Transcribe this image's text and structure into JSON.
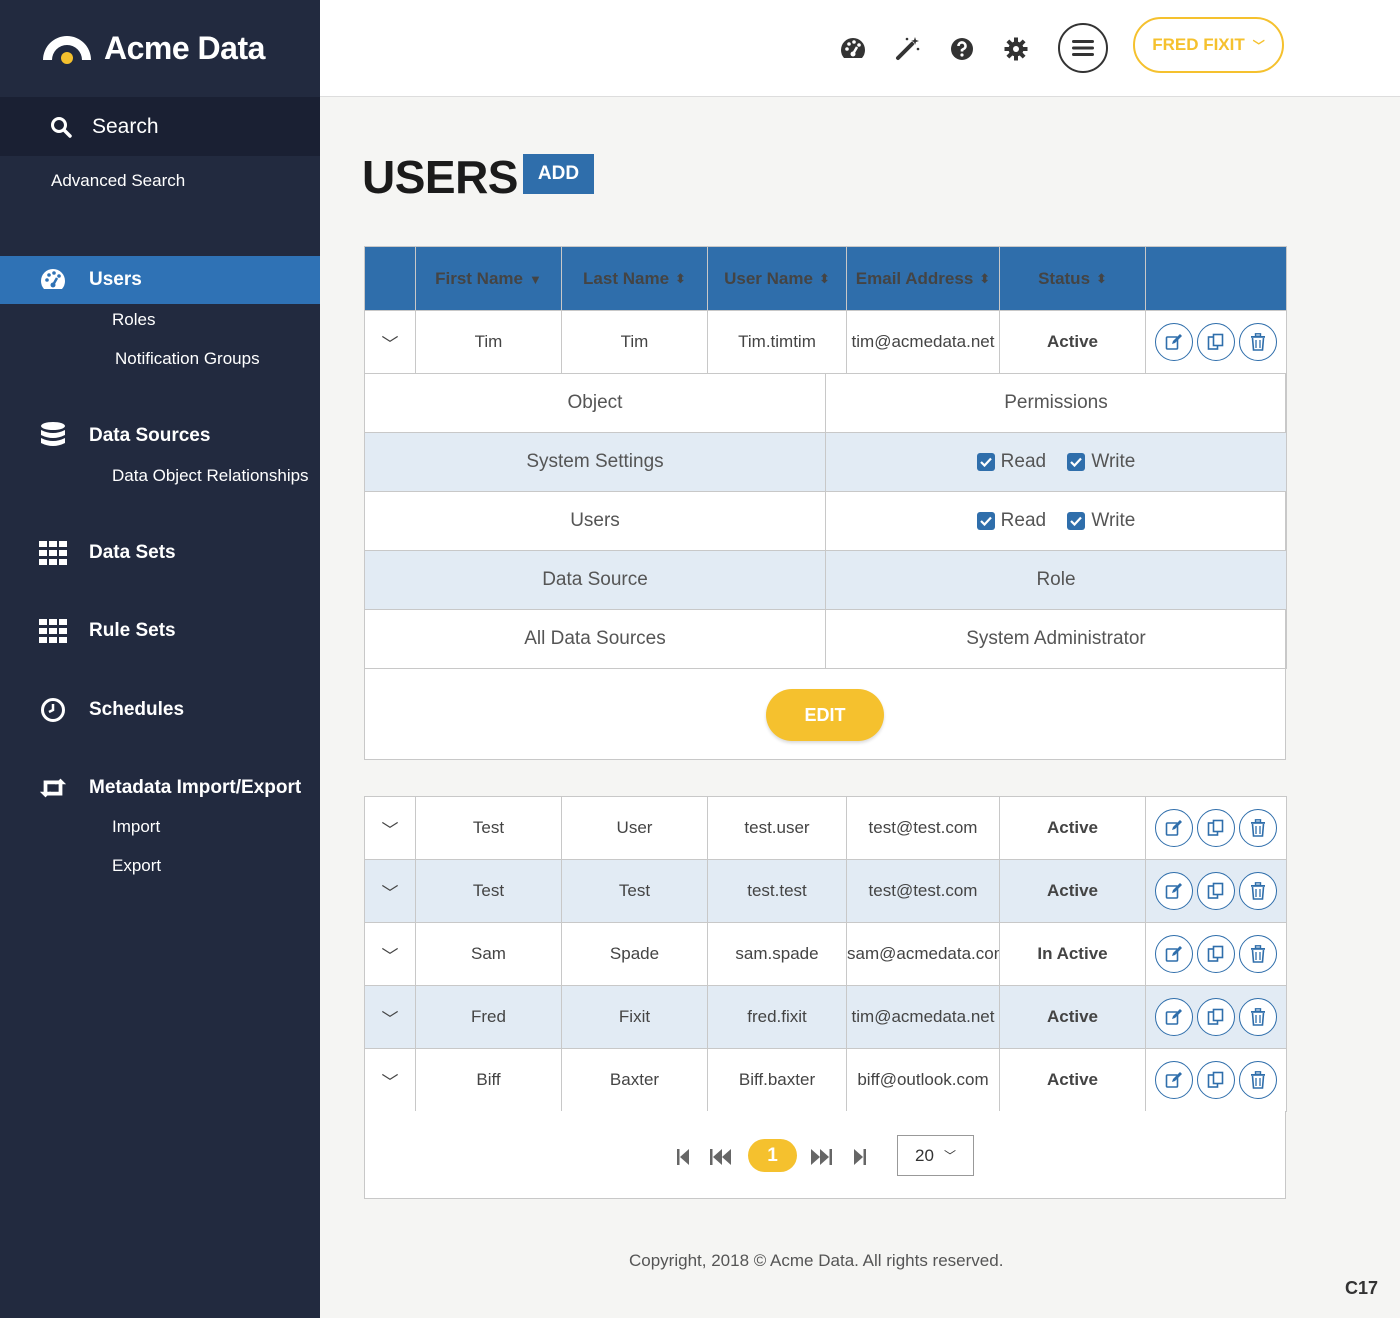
{
  "app": {
    "name": "Acme Data",
    "accent": "#2f6eab",
    "sidebar_bg": "#222a3f",
    "highlight": "#f5c12e"
  },
  "sidebar": {
    "search_label": "Search",
    "advanced_search": "Advanced Search",
    "nav": [
      {
        "label": "Users",
        "icon": "dashboard-icon",
        "active": true,
        "sub": [
          "Roles",
          "Notification Groups"
        ]
      },
      {
        "label": "Data Sources",
        "icon": "database-icon",
        "sub": [
          "Data Object Relationships"
        ]
      },
      {
        "label": "Data Sets",
        "icon": "grid-icon",
        "sub": []
      },
      {
        "label": "Rule Sets",
        "icon": "grid-icon",
        "sub": []
      },
      {
        "label": "Schedules",
        "icon": "clock-icon",
        "sub": []
      },
      {
        "label": "Metadata Import/Export",
        "icon": "retweet-icon",
        "sub": [
          "Import",
          "Export"
        ]
      }
    ]
  },
  "header": {
    "user_name": "FRED FIXIT",
    "icons": [
      "dashboard-icon",
      "magic-wand-icon",
      "help-icon",
      "gear-icon",
      "menu-icon"
    ]
  },
  "page": {
    "title": "USERS",
    "add_label": "ADD"
  },
  "table": {
    "columns": [
      "First Name",
      "Last Name",
      "User Name",
      "Email Address",
      "Status"
    ],
    "expanded_row": {
      "first": "Tim",
      "last": "Tim",
      "user": "Tim.timtim",
      "email": "tim@acmedata.net",
      "status": "Active"
    },
    "detail": {
      "headers": [
        "Object",
        "Permissions"
      ],
      "rows": [
        {
          "object": "System Settings",
          "read": "Read",
          "write": "Write"
        },
        {
          "object": "Users",
          "read": "Read",
          "write": "Write"
        }
      ],
      "ds_headers": [
        "Data Source",
        "Role"
      ],
      "ds_row": [
        "All Data Sources",
        "System Administrator"
      ],
      "edit_label": "EDIT"
    },
    "rows": [
      {
        "first": "Test",
        "last": "User",
        "user": "test.user",
        "email": "test@test.com",
        "status": "Active"
      },
      {
        "first": "Test",
        "last": "Test",
        "user": "test.test",
        "email": "test@test.com",
        "status": "Active"
      },
      {
        "first": "Sam",
        "last": "Spade",
        "user": "sam.spade",
        "email": "sam@acmedata.com",
        "status": "In Active"
      },
      {
        "first": "Fred",
        "last": "Fixit",
        "user": "fred.fixit",
        "email": "tim@acmedata.net",
        "status": "Active"
      },
      {
        "first": "Biff",
        "last": "Baxter",
        "user": "Biff.baxter",
        "email": "biff@outlook.com",
        "status": "Active"
      }
    ]
  },
  "pagination": {
    "current_page": "1",
    "page_size": "20"
  },
  "footer": {
    "copyright": "Copyright, 2018 © Acme Data. All rights reserved.",
    "code": "C17"
  }
}
